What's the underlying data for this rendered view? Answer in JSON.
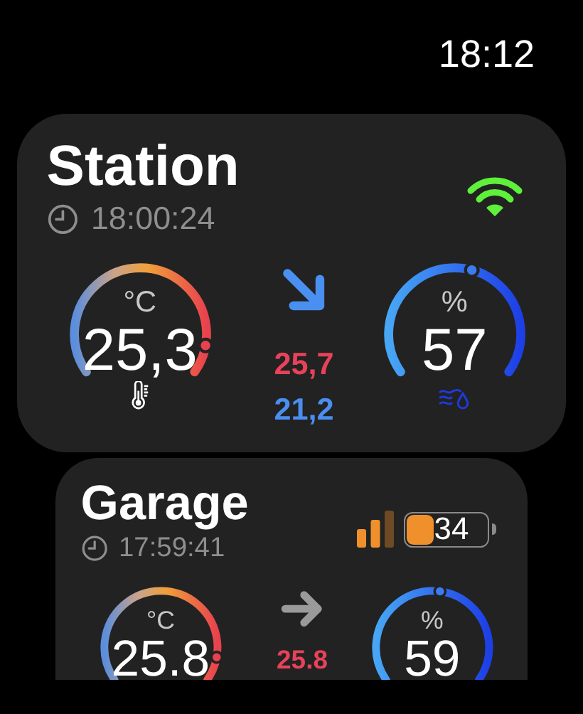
{
  "status_bar": {
    "time": "18:12"
  },
  "stations": [
    {
      "name": "Station",
      "updated": "18:00:24",
      "connection": {
        "kind": "wifi"
      },
      "temperature": {
        "unit": "°C",
        "value": "25,3",
        "trend_arrow": {
          "kind": "down"
        },
        "high": "25,7",
        "low": "21,2"
      },
      "humidity": {
        "unit": "%",
        "value": "57"
      }
    },
    {
      "name": "Garage",
      "updated": "17:59:41",
      "connection": {
        "kind": "cellular",
        "battery": "34"
      },
      "temperature": {
        "unit": "°C",
        "value": "25.8",
        "trend_arrow": {
          "kind": "steady"
        },
        "high": "25.8"
      },
      "humidity": {
        "unit": "%",
        "value": "59"
      }
    }
  ]
}
